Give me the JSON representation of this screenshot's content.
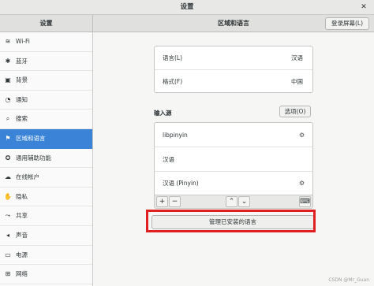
{
  "window": {
    "title": "设置",
    "close_glyph": "✕"
  },
  "header": {
    "back_glyph": "‹",
    "left_title": "设置",
    "main_title": "区域和语言",
    "login_screen_button": "登录屏幕(L)"
  },
  "sidebar": {
    "items": [
      {
        "icon": "wifi-icon",
        "glyph": "≋",
        "label": "Wi-Fi"
      },
      {
        "icon": "bluetooth-icon",
        "glyph": "✱",
        "label": "蓝牙"
      },
      {
        "icon": "background-icon",
        "glyph": "▣",
        "label": "背景"
      },
      {
        "icon": "notification-icon",
        "glyph": "◔",
        "label": "通知"
      },
      {
        "icon": "search-icon",
        "glyph": "⌕",
        "label": "搜索"
      },
      {
        "icon": "region-icon",
        "glyph": "⚑",
        "label": "区域和语言"
      },
      {
        "icon": "accessibility-icon",
        "glyph": "✪",
        "label": "通用辅助功能"
      },
      {
        "icon": "online-accounts-icon",
        "glyph": "☁",
        "label": "在线帐户"
      },
      {
        "icon": "privacy-icon",
        "glyph": "✋",
        "label": "隐私"
      },
      {
        "icon": "sharing-icon",
        "glyph": "⤳",
        "label": "共享"
      },
      {
        "icon": "sound-icon",
        "glyph": "◂",
        "label": "声音"
      },
      {
        "icon": "power-icon",
        "glyph": "▭",
        "label": "电源"
      },
      {
        "icon": "network-icon",
        "glyph": "⊞",
        "label": "网络"
      }
    ],
    "active_index": 5
  },
  "region": {
    "language_label": "语言(L)",
    "language_value": "汉语",
    "formats_label": "格式(F)",
    "formats_value": "中国"
  },
  "input_sources": {
    "title": "输入源",
    "options_button": "选项(O)",
    "items": [
      {
        "label": "libpinyin",
        "has_settings": true
      },
      {
        "label": "汉语",
        "has_settings": false
      },
      {
        "label": "汉语 (Pinyin)",
        "has_settings": true
      }
    ],
    "settings_glyph": "⚙",
    "add_glyph": "+",
    "remove_glyph": "−",
    "up_glyph": "⌃",
    "down_glyph": "⌄",
    "keyboard_glyph": "⌨"
  },
  "manage_button": "管理已安装的语言",
  "colors": {
    "accent": "#3a83d6",
    "highlight": "#e02020"
  },
  "watermark": "CSDN @Mr_Guan"
}
